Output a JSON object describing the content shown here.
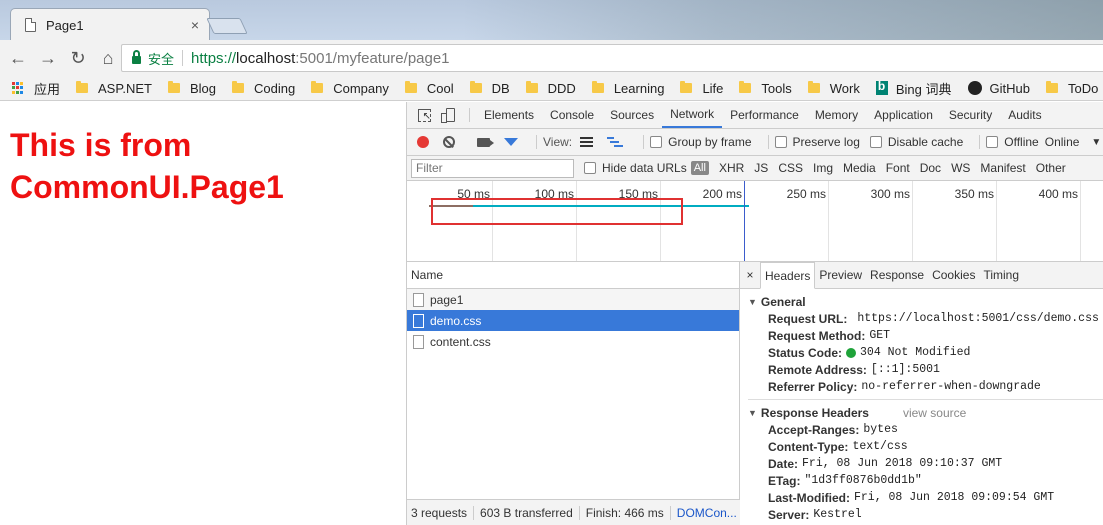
{
  "tab": {
    "title": "Page1",
    "close": "×"
  },
  "toolbar": {
    "back": "←",
    "forward": "→",
    "reload": "↻",
    "home": "⌂",
    "secure_label": "安全",
    "url_scheme": "https://",
    "url_host": "localhost",
    "url_path": ":5001/myfeature/page1"
  },
  "bookmarks": {
    "apps_label": "应用",
    "items": [
      "ASP.NET",
      "Blog",
      "Coding",
      "Company",
      "Cool",
      "DB",
      "DDD",
      "Learning",
      "Life",
      "Tools",
      "Work"
    ],
    "bing": "Bing 词典",
    "github": "GitHub",
    "todo": "ToDo"
  },
  "page": {
    "heading_line1": "This is from",
    "heading_line2": "CommonUI.Page1",
    "heading_color": "#ee1111"
  },
  "devtools": {
    "tabs": [
      "Elements",
      "Console",
      "Sources",
      "Network",
      "Performance",
      "Memory",
      "Application",
      "Security",
      "Audits"
    ],
    "active_tab": "Network",
    "network_toolbar": {
      "view_label": "View:",
      "group_by_frame": "Group by frame",
      "preserve_log": "Preserve log",
      "disable_cache": "Disable cache",
      "offline": "Offline",
      "online": "Online",
      "dropdown": "▼"
    },
    "filter": {
      "placeholder": "Filter",
      "hide_data_urls": "Hide data URLs",
      "all": "All",
      "types": [
        "XHR",
        "JS",
        "CSS",
        "Img",
        "Media",
        "Font",
        "Doc",
        "WS",
        "Manifest",
        "Other"
      ]
    },
    "timeline": {
      "ticks": [
        "50 ms",
        "100 ms",
        "150 ms",
        "200 ms",
        "250 ms",
        "300 ms",
        "350 ms",
        "400 ms"
      ]
    },
    "requests": {
      "name_header": "Name",
      "rows": [
        {
          "name": "page1",
          "selected": false
        },
        {
          "name": "demo.css",
          "selected": true
        },
        {
          "name": "content.css",
          "selected": false
        }
      ],
      "footer": {
        "count": "3 requests",
        "transferred": "603 B transferred",
        "finish": "Finish: 466 ms",
        "domcontent": "DOMCon..."
      }
    },
    "details": {
      "close": "×",
      "tabs": [
        "Headers",
        "Preview",
        "Response",
        "Cookies",
        "Timing"
      ],
      "active_tab": "Headers",
      "general_title": "General",
      "general": [
        {
          "key": "Request URL:",
          "value": "https://localhost:5001/css/demo.css"
        },
        {
          "key": "Request Method:",
          "value": "GET"
        },
        {
          "key": "Status Code:",
          "value": "304 Not Modified"
        },
        {
          "key": "Remote Address:",
          "value": "[::1]:5001"
        },
        {
          "key": "Referrer Policy:",
          "value": "no-referrer-when-downgrade"
        }
      ],
      "response_title": "Response Headers",
      "view_source": "view source",
      "response": [
        {
          "key": "Accept-Ranges:",
          "value": "bytes"
        },
        {
          "key": "Content-Type:",
          "value": "text/css"
        },
        {
          "key": "Date:",
          "value": "Fri, 08 Jun 2018 09:10:37 GMT"
        },
        {
          "key": "ETag:",
          "value": "\"1d3ff0876b0dd1b\""
        },
        {
          "key": "Last-Modified:",
          "value": "Fri, 08 Jun 2018 09:09:54 GMT"
        },
        {
          "key": "Server:",
          "value": "Kestrel"
        }
      ]
    }
  },
  "colors": {
    "accent_blue": "#3879d9",
    "status_green": "#1fa33a",
    "highlight_red": "#e03131",
    "record_red": "#e53935"
  }
}
